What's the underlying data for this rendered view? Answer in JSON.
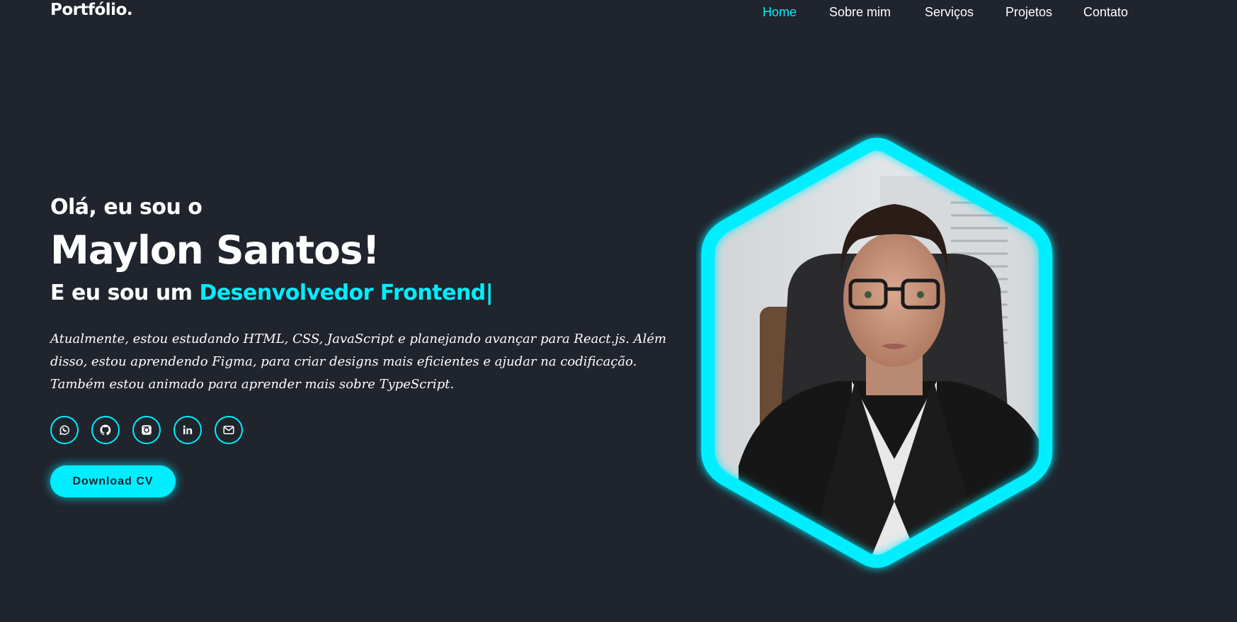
{
  "header": {
    "logo": "Portfólio.",
    "nav": [
      {
        "label": "Home",
        "active": true
      },
      {
        "label": "Sobre mim",
        "active": false
      },
      {
        "label": "Serviços",
        "active": false
      },
      {
        "label": "Projetos",
        "active": false
      },
      {
        "label": "Contato",
        "active": false
      }
    ]
  },
  "home": {
    "greeting": "Olá, eu sou o",
    "name": "Maylon Santos!",
    "role_prefix": "E eu sou um",
    "role_accent": "Desenvolvedor Frontend",
    "role_cursor": "|",
    "description": "Atualmente, estou estudando HTML, CSS, JavaScript e planejando avançar para React.js. Além disso, estou aprendendo Figma, para criar designs mais eficientes e ajudar na codificação. Também estou animado para aprender mais sobre TypeScript.",
    "social": [
      {
        "name": "whatsapp",
        "icon": "whatsapp-icon"
      },
      {
        "name": "github",
        "icon": "github-icon"
      },
      {
        "name": "instagram",
        "icon": "instagram-icon"
      },
      {
        "name": "linkedin",
        "icon": "linkedin-icon"
      },
      {
        "name": "email",
        "icon": "mail-icon"
      }
    ],
    "button_label": "Download CV",
    "photo_icon": "profile-photo"
  },
  "colors": {
    "background": "#1f242d",
    "accent": "#00eeff",
    "text": "#ffffff"
  }
}
